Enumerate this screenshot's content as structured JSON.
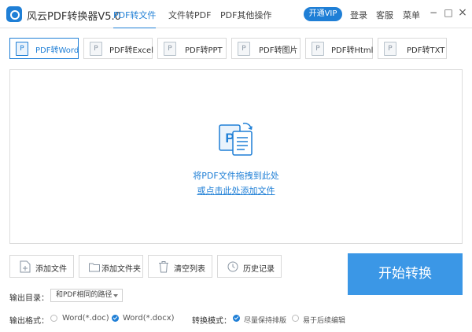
{
  "app": {
    "title": "风云PDF转换器V5.0"
  },
  "nav": {
    "tabs": [
      "PDF转文件",
      "文件转PDF",
      "PDF其他操作"
    ],
    "active_index": 0
  },
  "top": {
    "vip_label": "开通VIP",
    "login_label": "登录",
    "service_label": "客服",
    "menu_label": "菜单",
    "minimize_glyph": "−",
    "maximize_glyph": "□",
    "close_glyph": "×"
  },
  "formats": {
    "tabs": [
      "PDF转Word",
      "PDF转Excel",
      "PDF转PPT",
      "PDF转图片",
      "PDF转Html",
      "PDF转TXT"
    ],
    "active_index": 0,
    "icon_glyph": "P"
  },
  "drop": {
    "text": "将PDF文件拖拽到此处",
    "link": "或点击此处添加文件"
  },
  "actions": {
    "add_file": "添加文件",
    "add_folder": "添加文件夹",
    "clear_list": "清空列表",
    "history": "历史记录"
  },
  "start": {
    "label": "开始转换"
  },
  "output": {
    "dir_label": "输出目录：",
    "dir_value": "和PDF相同的路径",
    "format_label": "输出格式：",
    "format_options": [
      "Word(*.doc)",
      "Word(*.docx)"
    ],
    "format_selected": 1
  },
  "mode": {
    "label": "转换模式：",
    "options": [
      "尽量保持排版",
      "易于后续编辑"
    ],
    "selected": 0
  },
  "colors": {
    "accent": "#1f7fd6",
    "start_button": "#3b97e6"
  }
}
